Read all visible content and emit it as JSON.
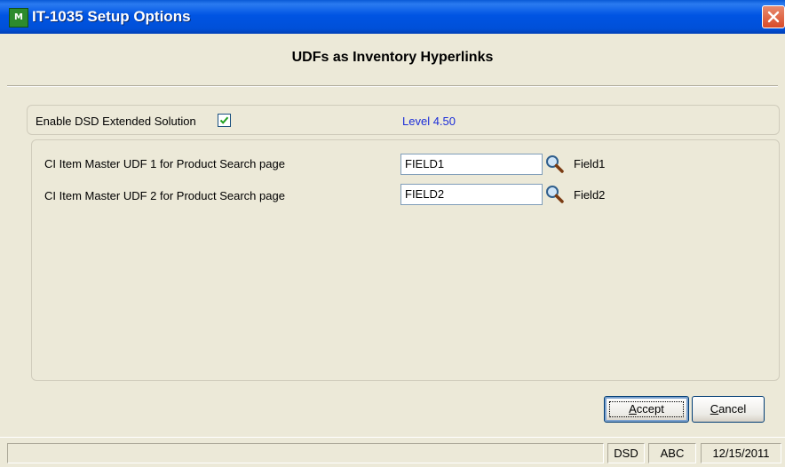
{
  "window": {
    "title": "IT-1035 Setup Options",
    "icon_text": "M"
  },
  "heading": "UDFs as Inventory Hyperlinks",
  "enable": {
    "label": "Enable DSD Extended Solution",
    "checked": true,
    "level": "Level  4.50"
  },
  "fields": [
    {
      "label": "CI Item Master UDF 1 for Product Search page",
      "value": "FIELD1",
      "description": "Field1"
    },
    {
      "label": "CI Item Master UDF 2 for Product Search page",
      "value": "FIELD2",
      "description": "Field2"
    }
  ],
  "buttons": {
    "accept_prefix": "A",
    "accept_rest": "ccept",
    "cancel_prefix": "C",
    "cancel_rest": "ancel"
  },
  "status": {
    "main": "",
    "company_code": "DSD",
    "company": "ABC",
    "date": "12/15/2011"
  },
  "colors": {
    "titlebar": "#0054e3",
    "level_text": "#1b2dd8",
    "check": "#21a121"
  }
}
